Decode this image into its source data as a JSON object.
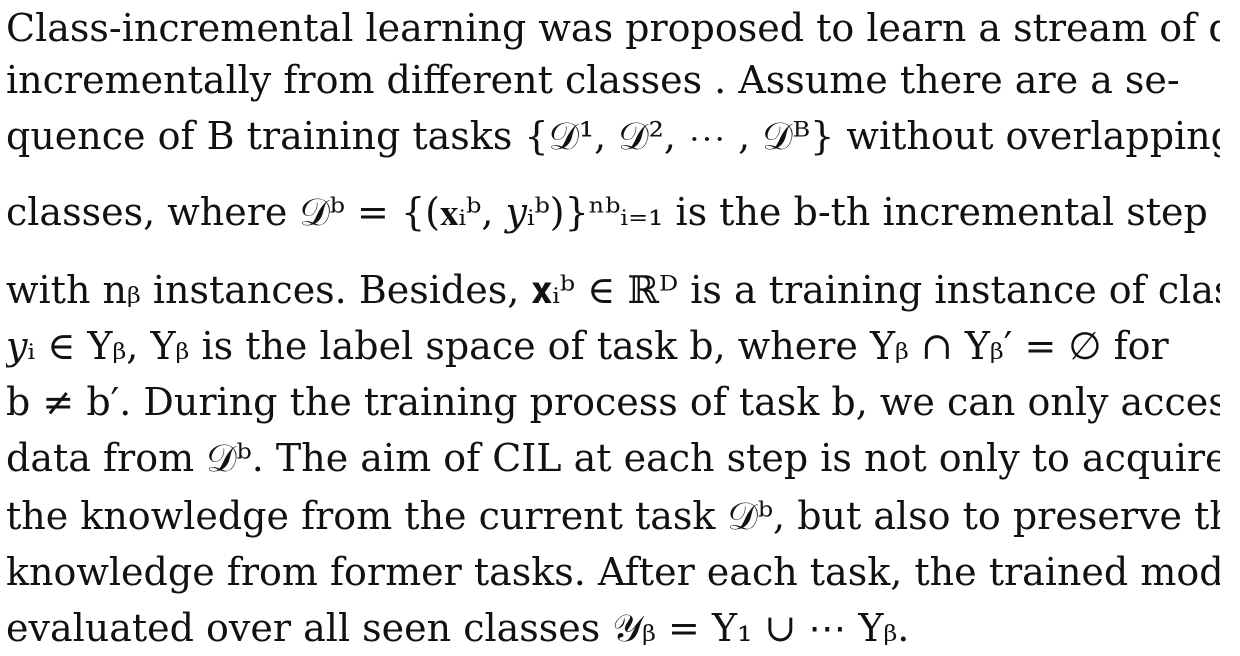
{
  "paragraph": {
    "lines": [
      "Class-incremental learning was proposed to learn a stream of data",
      "incrementally from different classes      . Assume there are a se-",
      "quence of B training tasks {𝒟¹, 𝒟², ⋯ , 𝒟ᴮ} without overlapping",
      "classes, where 𝒟ᵇ  =  {(𝐱ᵢᵇ, 𝑦ᵢᵇ)}ⁿᵇᵢ₌₁  is the b-th incremental step",
      "with nᵦ instances. Besides, 𝐱ᵢᵇ ∈ ℝᴰ is a training instance of class",
      "𝑦ᵢ ∈ Yᵦ, Yᵦ is the label space of task b, where Yᵦ ∩ Yᵦ′  = ∅ for",
      "b ≠ b′. During the training process of task b, we can only access",
      "data from 𝒟ᵇ. The aim of CIL at each step is not only to acquire",
      "the knowledge from the current task 𝒟ᵇ, but also to preserve the",
      "knowledge from former tasks. After each task, the trained model is",
      "evaluated over all seen classes 𝒴ᵦ = Y₁ ∪ ⋯ Yᵦ."
    ]
  }
}
